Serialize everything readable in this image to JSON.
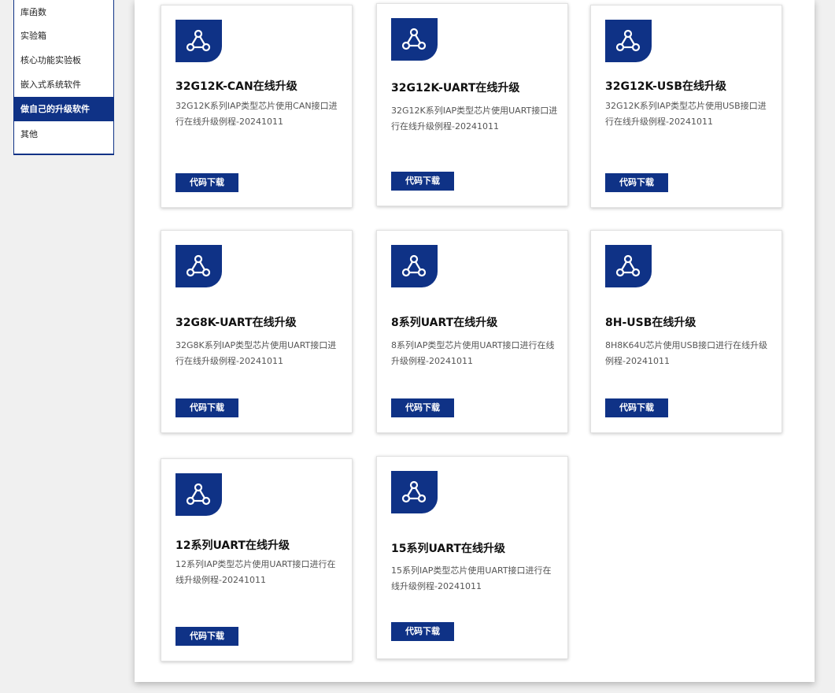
{
  "sidebar": {
    "items": [
      {
        "label": "库函数"
      },
      {
        "label": "实验箱"
      },
      {
        "label": "核心功能实验板"
      },
      {
        "label": "嵌入式系统软件"
      },
      {
        "label": "做自己的升级软件"
      },
      {
        "label": "其他"
      }
    ],
    "active_index": 4
  },
  "colors": {
    "brand": "#0f3286",
    "background": "#f0f0f0"
  },
  "cards": [
    {
      "title": "32G12K-CAN在线升级",
      "desc": "32G12K系列IAP类型芯片使用CAN接口进行在线升级例程-20241011",
      "button": "代码下载",
      "icon": "share-nodes-icon"
    },
    {
      "title": "32G12K-UART在线升级",
      "desc": "32G12K系列IAP类型芯片使用UART接口进行在线升级例程-20241011",
      "button": "代码下载",
      "icon": "share-nodes-icon"
    },
    {
      "title": "32G12K-USB在线升级",
      "desc": "32G12K系列IAP类型芯片使用USB接口进行在线升级例程-20241011",
      "button": "代码下载",
      "icon": "share-nodes-icon"
    },
    {
      "title": "32G8K-UART在线升级",
      "desc": "32G8K系列IAP类型芯片使用UART接口进行在线升级例程-20241011",
      "button": "代码下载",
      "icon": "share-nodes-icon"
    },
    {
      "title": "8系列UART在线升级",
      "desc": "8系列IAP类型芯片使用UART接口进行在线升级例程-20241011",
      "button": "代码下载",
      "icon": "share-nodes-icon"
    },
    {
      "title": "8H-USB在线升级",
      "desc": "8H8K64U芯片使用USB接口进行在线升级例程-20241011",
      "button": "代码下载",
      "icon": "share-nodes-icon"
    },
    {
      "title": "12系列UART在线升级",
      "desc": "12系列IAP类型芯片使用UART接口进行在线升级例程-20241011",
      "button": "代码下载",
      "icon": "share-nodes-icon"
    },
    {
      "title": "15系列UART在线升级",
      "desc": "15系列IAP类型芯片使用UART接口进行在线升级例程-20241011",
      "button": "代码下载",
      "icon": "share-nodes-icon"
    }
  ]
}
